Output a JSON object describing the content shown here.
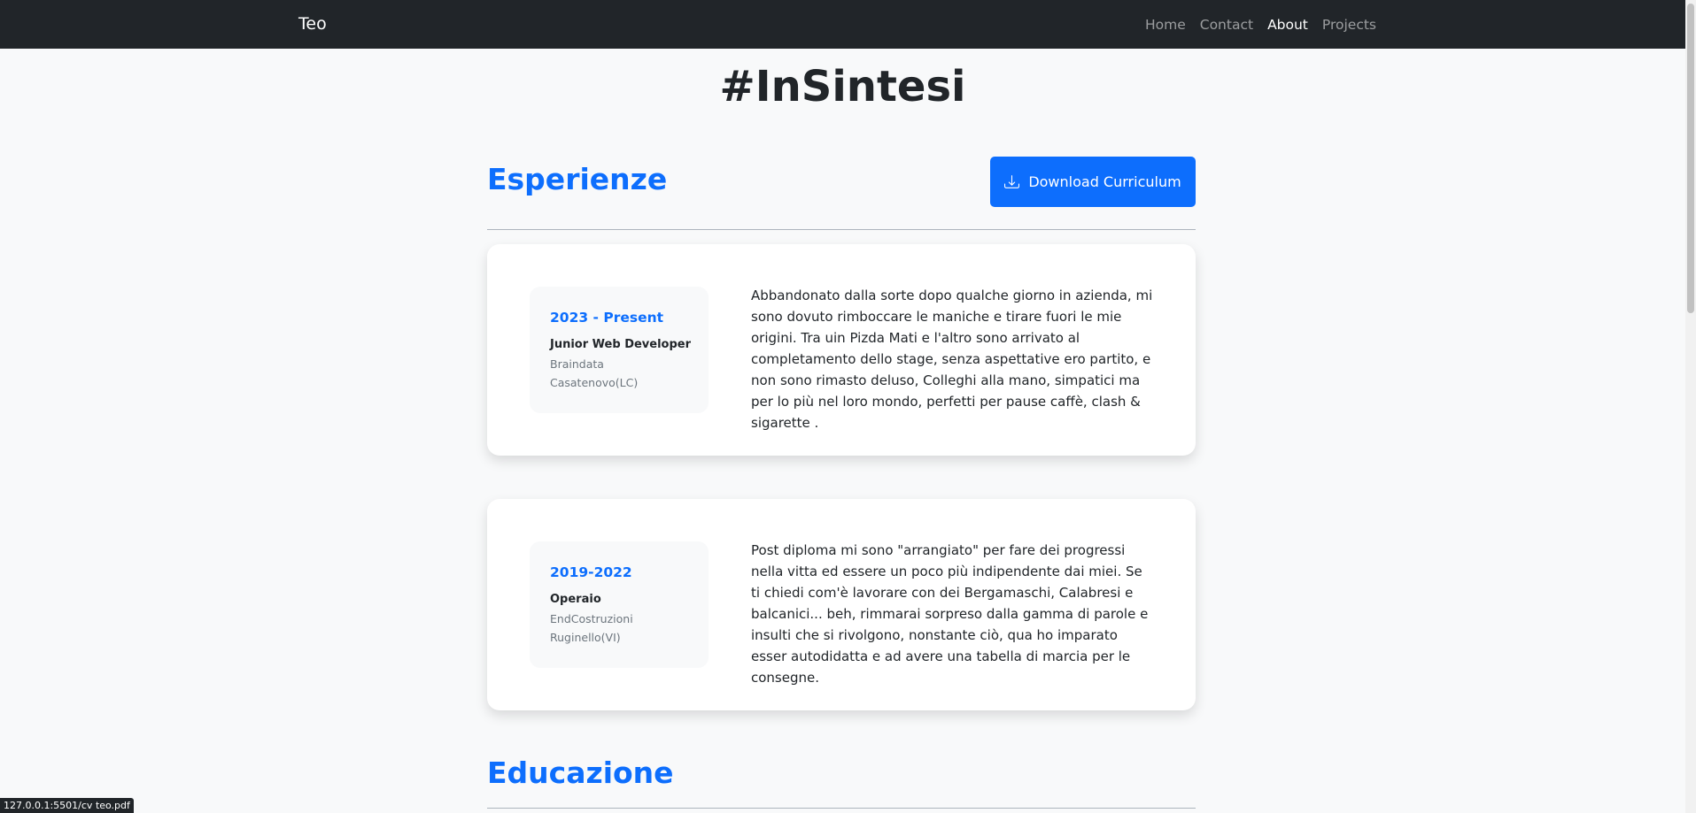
{
  "navbar": {
    "brand": "Teo",
    "links": [
      {
        "label": "Home"
      },
      {
        "label": "Contact"
      },
      {
        "label": "About"
      },
      {
        "label": "Projects"
      }
    ]
  },
  "page": {
    "title": "#InSintesi"
  },
  "experience": {
    "section_title": "Esperienze",
    "download_label": "Download Curriculum",
    "items": [
      {
        "period": "2023 - Present",
        "role": "Junior Web Developer",
        "company": "Braindata",
        "location": "Casatenovo(LC)",
        "description": "Abbandonato dalla sorte dopo qualche giorno in azienda, mi sono dovuto rimboccare le maniche e tirare fuori le mie origini. Tra uin Pizda Mati e l'altro sono arrivato al completamento dello stage, senza aspettative ero partito, e non sono rimasto deluso, Colleghi alla mano, simpatici ma per lo più nel loro mondo, perfetti per pause caffè, clash & sigarette ."
      },
      {
        "period": "2019-2022",
        "role": "Operaio",
        "company": "EndCostruzioni",
        "location": "Ruginello(VI)",
        "description": "Post diploma mi sono \"arrangiato\" per fare dei progressi nella vitta ed essere un poco più indipendente dai miei. Se ti chiedi com'è lavorare con dei Bergamaschi, Calabresi e balcanici... beh, rimmarai sorpreso dalla gamma di parole e insulti che si rivolgono, nonstante ciò, qua ho imparato esser autodidatta e ad avere una tabella di marcia per le consegne."
      }
    ]
  },
  "education": {
    "section_title": "Educazione"
  },
  "status_bar": {
    "url": "127.0.0.1:5501/cv teo.pdf"
  },
  "icons": {
    "download": "download-icon"
  },
  "colors": {
    "navbar_bg": "#212529",
    "accent": "#0d6efd",
    "page_bg": "#f8f9fa",
    "card_bg": "#ffffff",
    "muted_text": "#6c757d"
  }
}
